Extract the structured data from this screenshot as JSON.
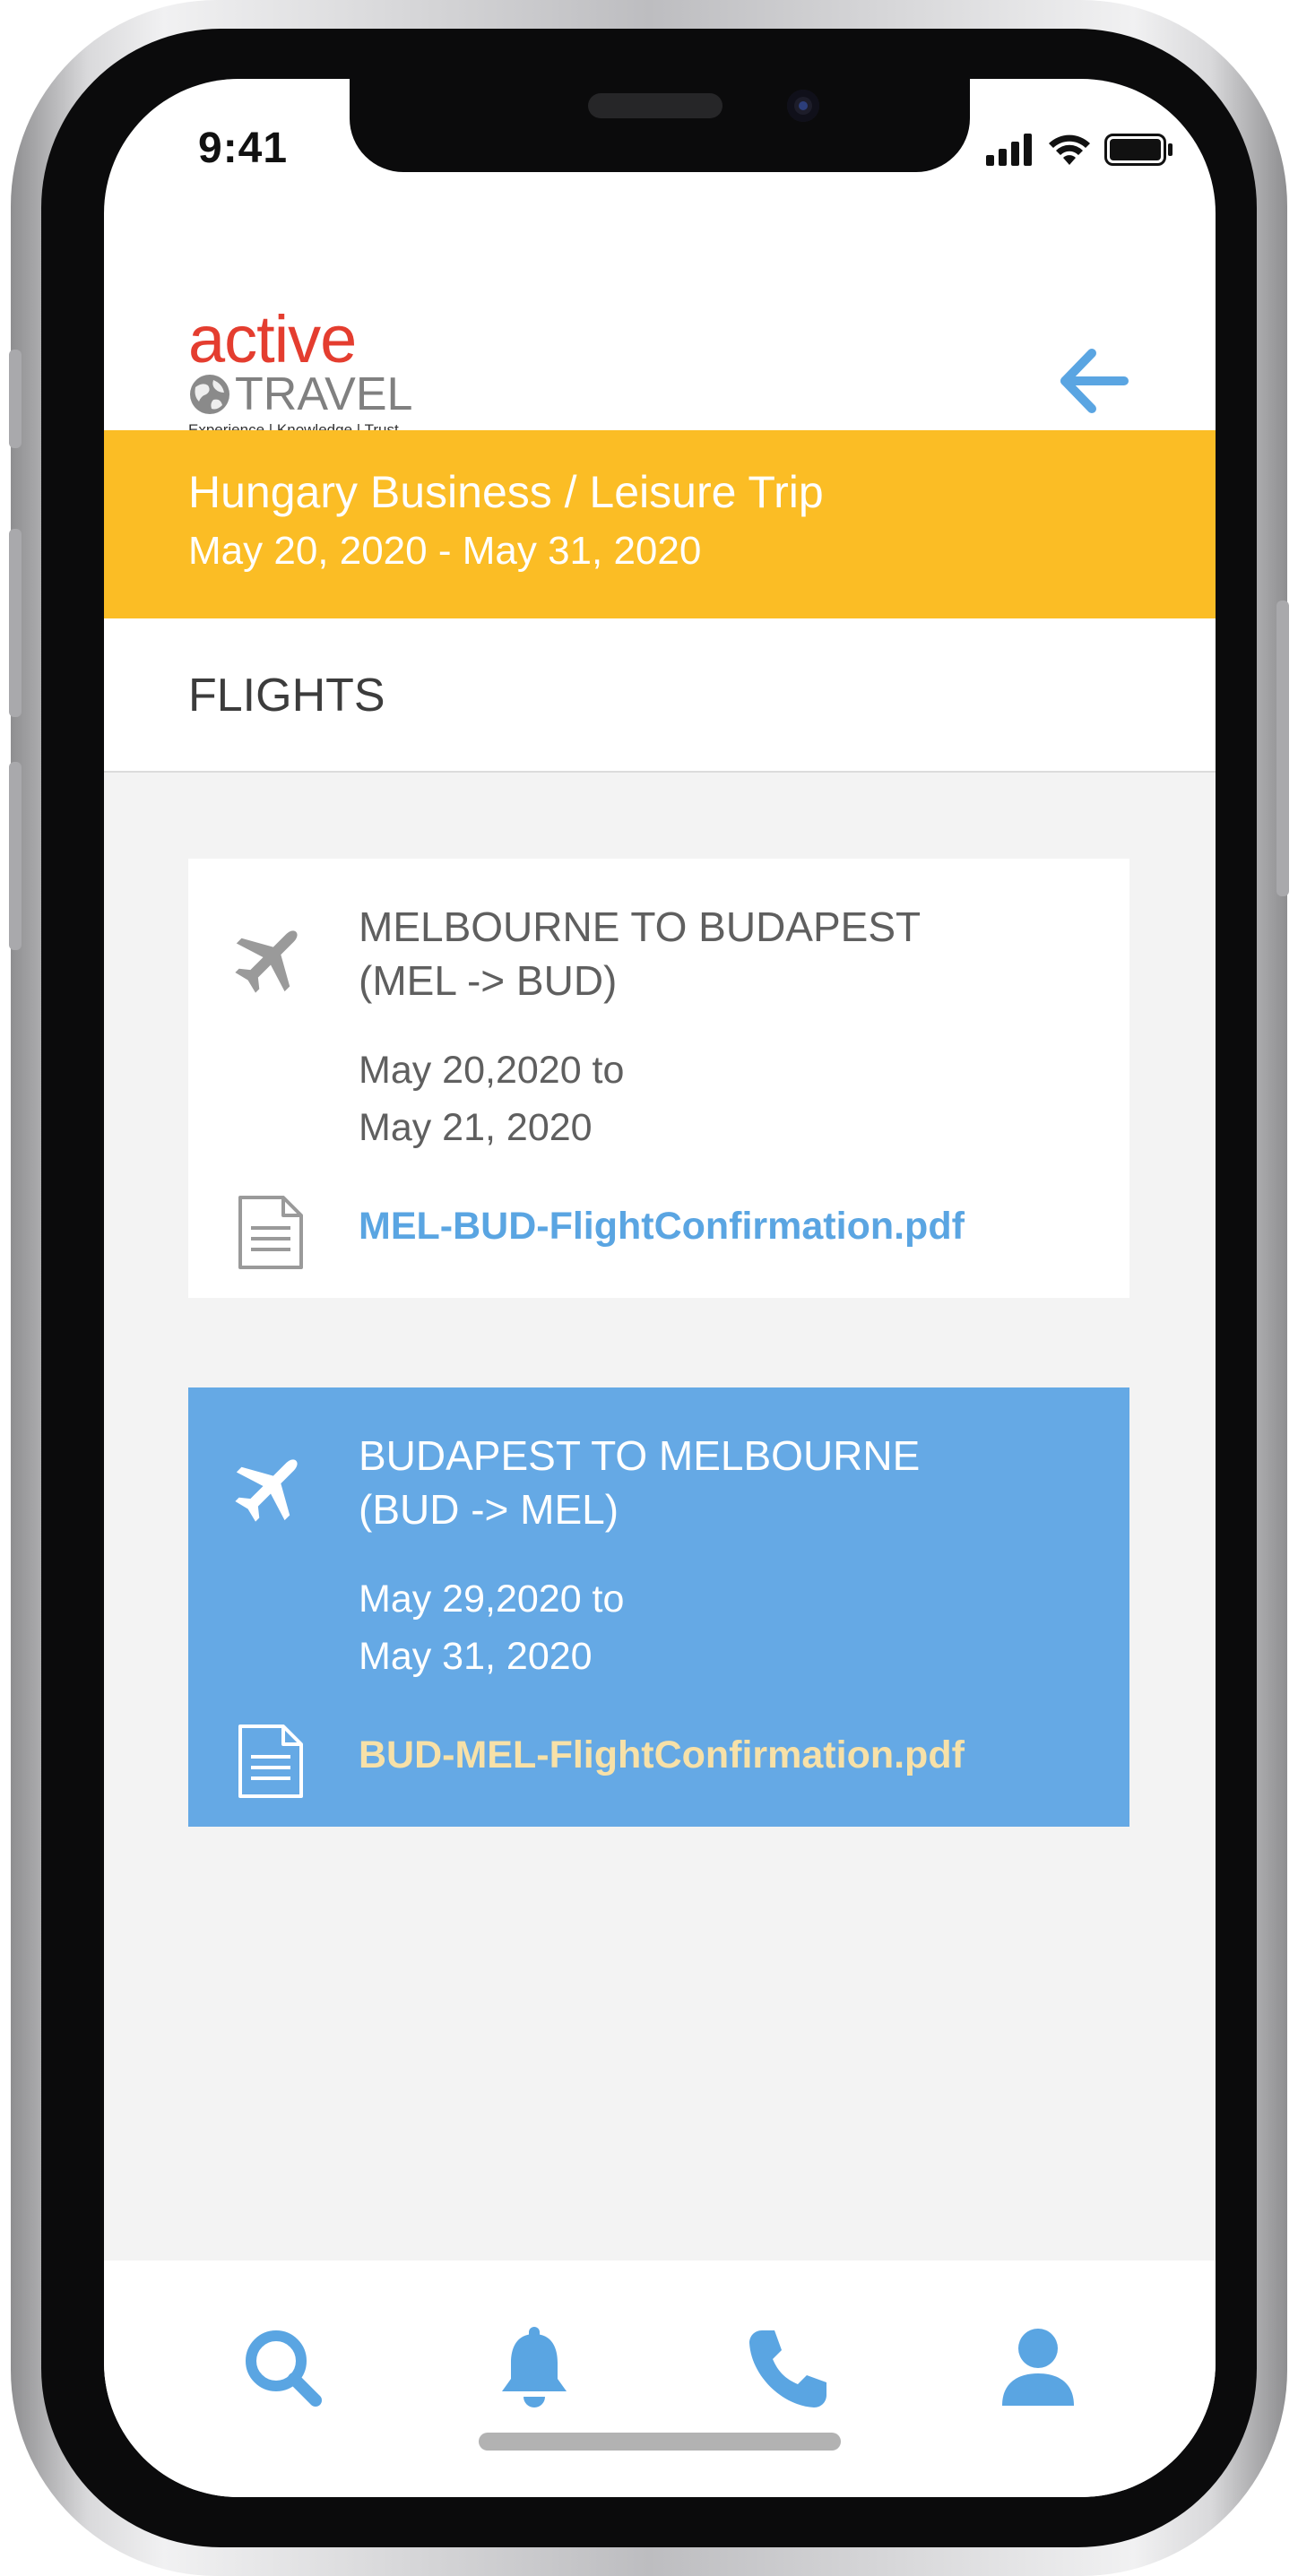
{
  "status_bar": {
    "time": "9:41"
  },
  "brand": {
    "name_top": "active",
    "name_bottom": "TRAVEL",
    "tagline": "Experience | Knowledge | Trust"
  },
  "header": {
    "back_icon": "arrow-left-icon"
  },
  "trip": {
    "title": "Hungary Business / Leisure Trip",
    "dates": "May 20, 2020 - May 31, 2020"
  },
  "section": {
    "title": "FLIGHTS"
  },
  "flights": [
    {
      "route_line1": "MELBOURNE TO BUDAPEST",
      "route_line2": "(MEL -> BUD)",
      "date_line1": "May 20,2020 to",
      "date_line2": "May 21, 2020",
      "file": "MEL-BUD-FlightConfirmation.pdf",
      "selected": false
    },
    {
      "route_line1": "BUDAPEST TO MELBOURNE",
      "route_line2": "(BUD -> MEL)",
      "date_line1": "May 29,2020 to",
      "date_line2": "May 31, 2020",
      "file": "BUD-MEL-FlightConfirmation.pdf",
      "selected": true
    }
  ],
  "nav": {
    "items": [
      "search-icon",
      "bell-icon",
      "phone-icon",
      "user-icon"
    ]
  },
  "colors": {
    "accent_blue": "#65a9e5",
    "banner_yellow": "#fbbd25",
    "brand_red": "#e43d2f",
    "file_link_selected": "#f7e1a8"
  }
}
